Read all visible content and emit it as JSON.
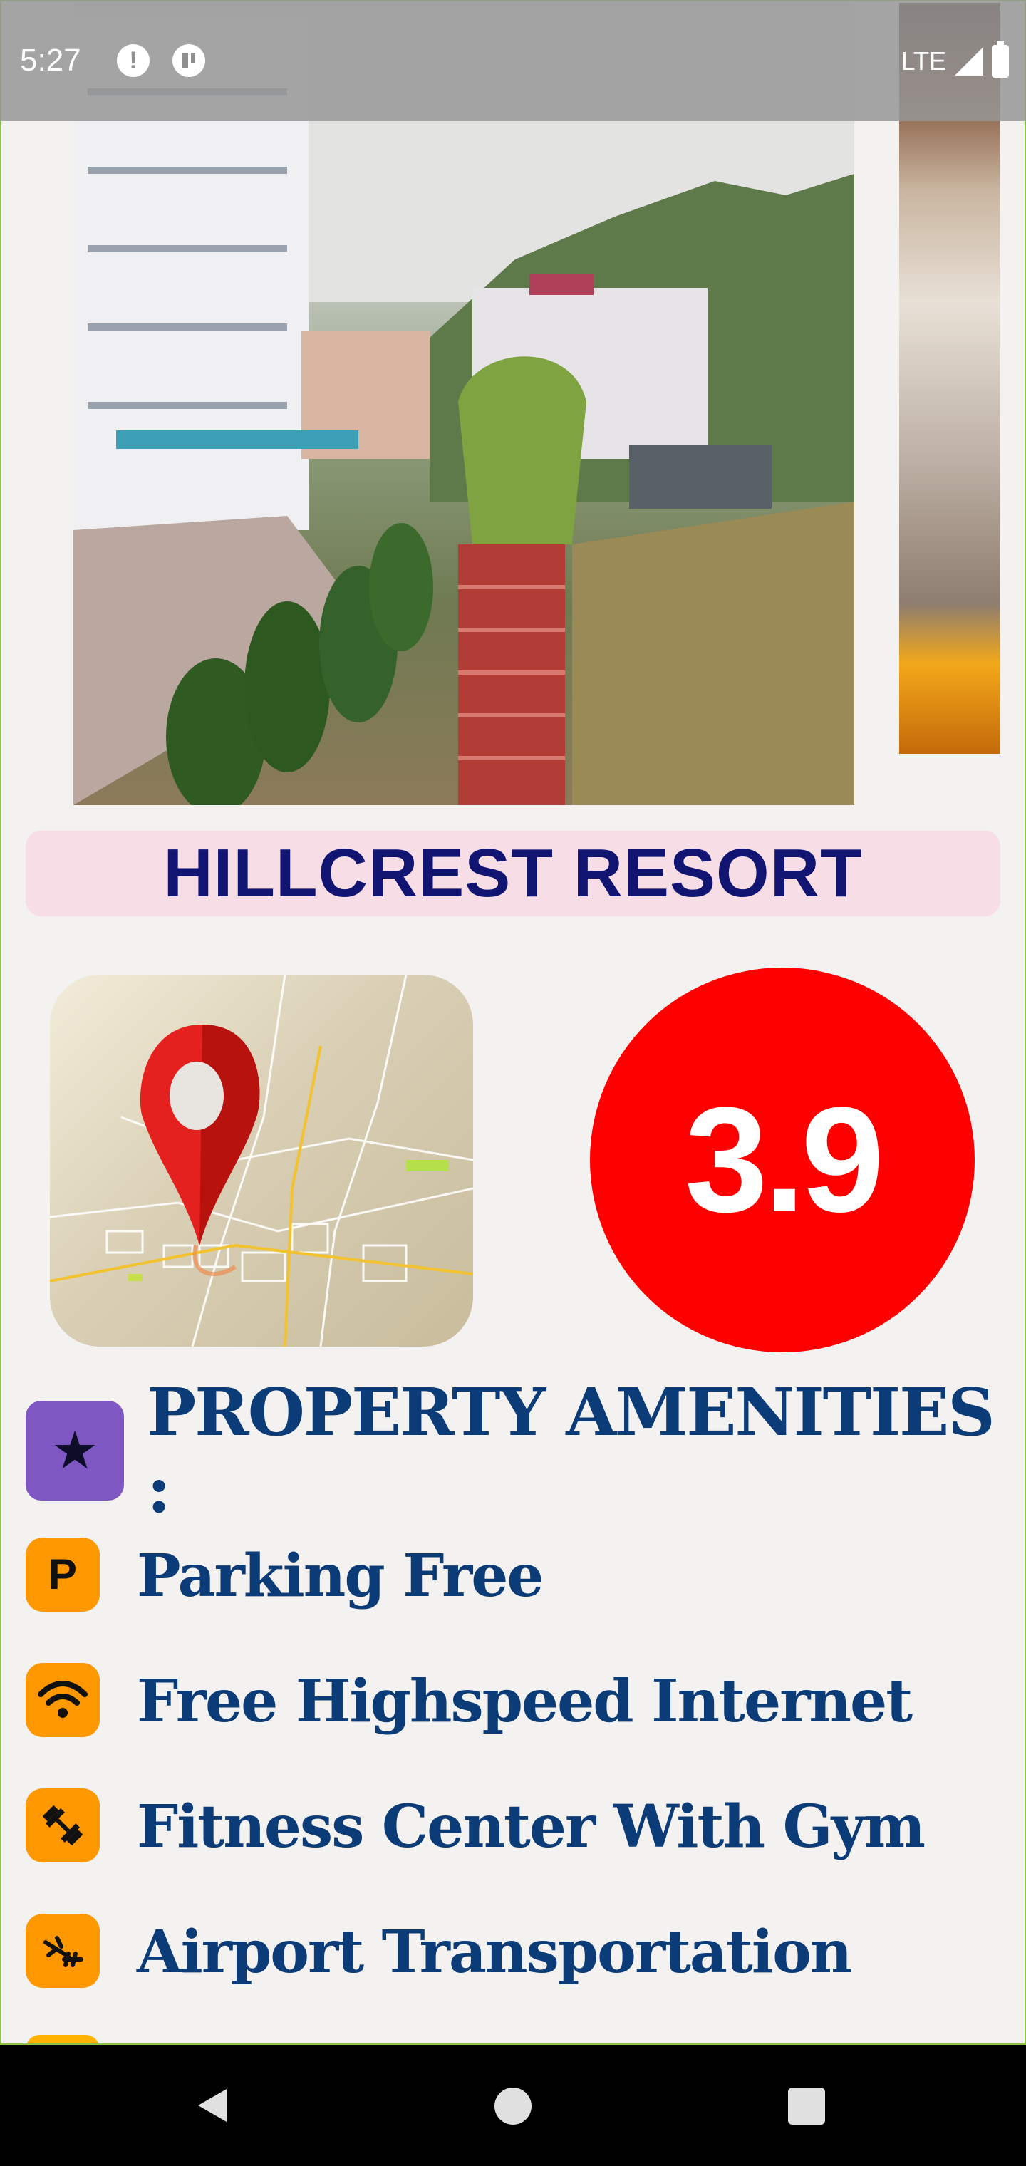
{
  "status_bar": {
    "time": "5:27",
    "alert_icon": "!",
    "network": "LTE"
  },
  "gallery": {
    "images": [
      "hotel-exterior-photo",
      "hotel-room-photo"
    ]
  },
  "hotel": {
    "name": "HILLCREST RESORT",
    "rating": "3.9"
  },
  "amenities": {
    "heading": "PROPERTY AMENITIES :",
    "items": [
      {
        "label": "Parking Free",
        "icon": "parking-icon"
      },
      {
        "label": "Free Highspeed Internet",
        "icon": "wifi-icon"
      },
      {
        "label": "Fitness Center With Gym",
        "icon": "dumbbell-icon"
      },
      {
        "label": "Airport Transportation",
        "icon": "airport-shuttle-icon"
      }
    ]
  },
  "colors": {
    "title_bg": "#f6dde6",
    "title_text": "#111470",
    "rating_bg": "#ff0000",
    "amenity_text": "#0c3c78",
    "amenity_icon_bg": "#ff9800",
    "star_badge_bg": "#7e57c2"
  }
}
